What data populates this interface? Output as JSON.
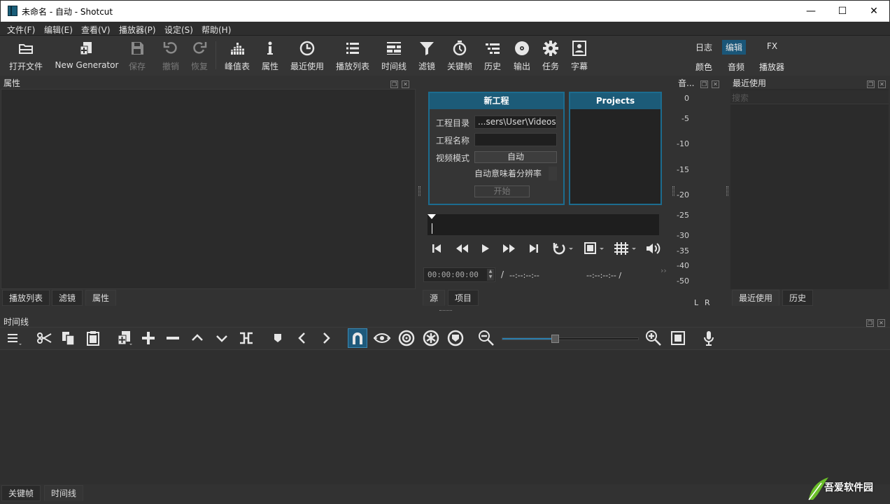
{
  "window": {
    "title": "未命名 - 自动 - Shotcut",
    "minimize": "—",
    "maximize": "☐",
    "close": "✕"
  },
  "menu": [
    "文件(F)",
    "编辑(E)",
    "查看(V)",
    "播放器(P)",
    "设定(S)",
    "帮助(H)"
  ],
  "toolbar": {
    "open_file": "打开文件",
    "new_generator": "New Generator",
    "save": "保存",
    "undo": "撤销",
    "redo": "恢复",
    "peak_meter": "峰值表",
    "properties": "属性",
    "recent": "最近使用",
    "playlist": "播放列表",
    "timeline": "时间线",
    "filters": "滤镜",
    "keyframes": "关键帧",
    "history": "历史",
    "export": "输出",
    "jobs": "任务",
    "subtitles": "字幕"
  },
  "layouts": {
    "row1": [
      "日志",
      "编辑",
      "FX"
    ],
    "row2": [
      "颜色",
      "音频",
      "播放器"
    ],
    "selected": "编辑"
  },
  "properties_panel": {
    "title": "属性",
    "tabs": [
      "播放列表",
      "滤镜",
      "属性"
    ],
    "active_tab": "属性"
  },
  "start_page": {
    "new_project": {
      "header": "新工程",
      "dir_label": "工程目录",
      "dir_value": "...sers\\User\\Videos",
      "name_label": "工程名称",
      "name_value": "",
      "mode_label": "视频模式",
      "mode_value": "自动",
      "mode_desc": "自动意味着分辨率",
      "start_button": "开始"
    },
    "projects": {
      "header": "Projects"
    }
  },
  "player": {
    "timecode": "00:00:00:00",
    "separator": "/",
    "duration": "--:--:--:--",
    "in_out": "--:--:--:-- /",
    "tabs": [
      "源",
      "项目"
    ],
    "active_tab": "源"
  },
  "audio_meter": {
    "title": "音...",
    "scale": [
      "0",
      "-5",
      "-10",
      "-15",
      "-20",
      "-25",
      "-30",
      "-35",
      "-40",
      "-50"
    ],
    "channels": [
      "L",
      "R"
    ]
  },
  "recent_panel": {
    "title": "最近使用",
    "search_placeholder": "搜索",
    "tabs": [
      "最近使用",
      "历史"
    ],
    "active_tab": "最近使用"
  },
  "timeline_panel": {
    "title": "时间线",
    "zoom_level": 0.36
  },
  "bottom_tabs": {
    "tabs": [
      "关键帧",
      "时间线"
    ],
    "active_tab": "时间线"
  },
  "watermark": {
    "text": "吾爱软件园"
  },
  "colors": {
    "accent": "#1a5678",
    "panel_bg": "#2b2b2b",
    "toolbar_bg": "#353535",
    "snap_active": "#1e5a7c"
  }
}
